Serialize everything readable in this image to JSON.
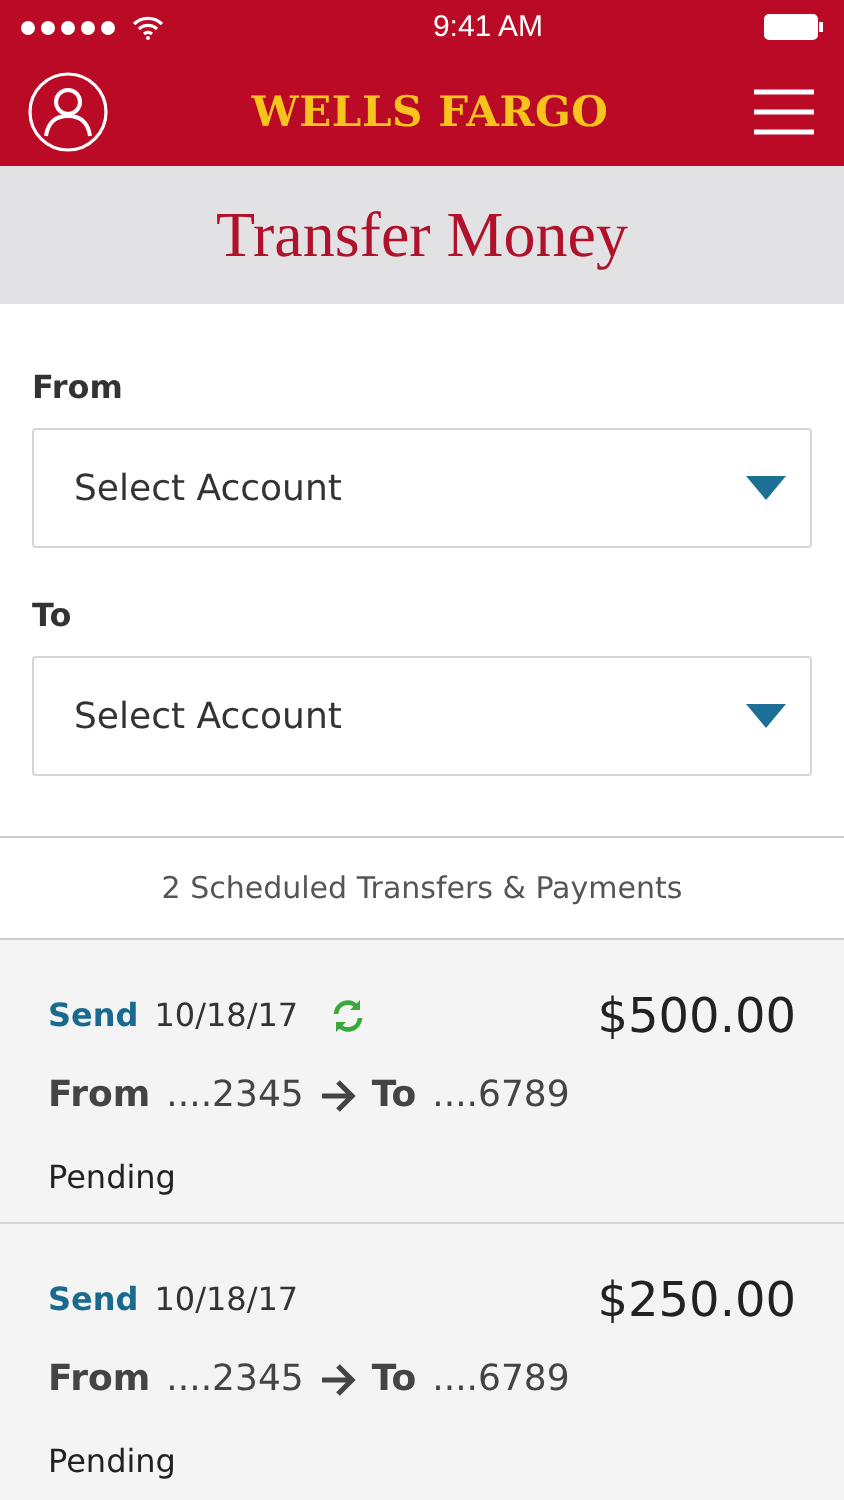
{
  "status_bar": {
    "time": "9:41 AM"
  },
  "header": {
    "logo": "WELLS FARGO"
  },
  "page_title": "Transfer Money",
  "fields": [
    {
      "label": "From",
      "value": "Select Account"
    },
    {
      "label": "To",
      "value": "Select Account"
    }
  ],
  "scheduled_heading": "2 Scheduled Transfers & Payments",
  "transfers": [
    {
      "type": "Send",
      "date": "10/18/17",
      "recurring": true,
      "amount": "$500.00",
      "from_label": "From",
      "from_account": "....2345",
      "to_label": "To",
      "to_account": "....6789",
      "status": "Pending"
    },
    {
      "type": "Send",
      "date": "10/18/17",
      "recurring": false,
      "amount": "$250.00",
      "from_label": "From",
      "from_account": "....2345",
      "to_label": "To",
      "to_account": "....6789",
      "status": "Pending"
    }
  ]
}
